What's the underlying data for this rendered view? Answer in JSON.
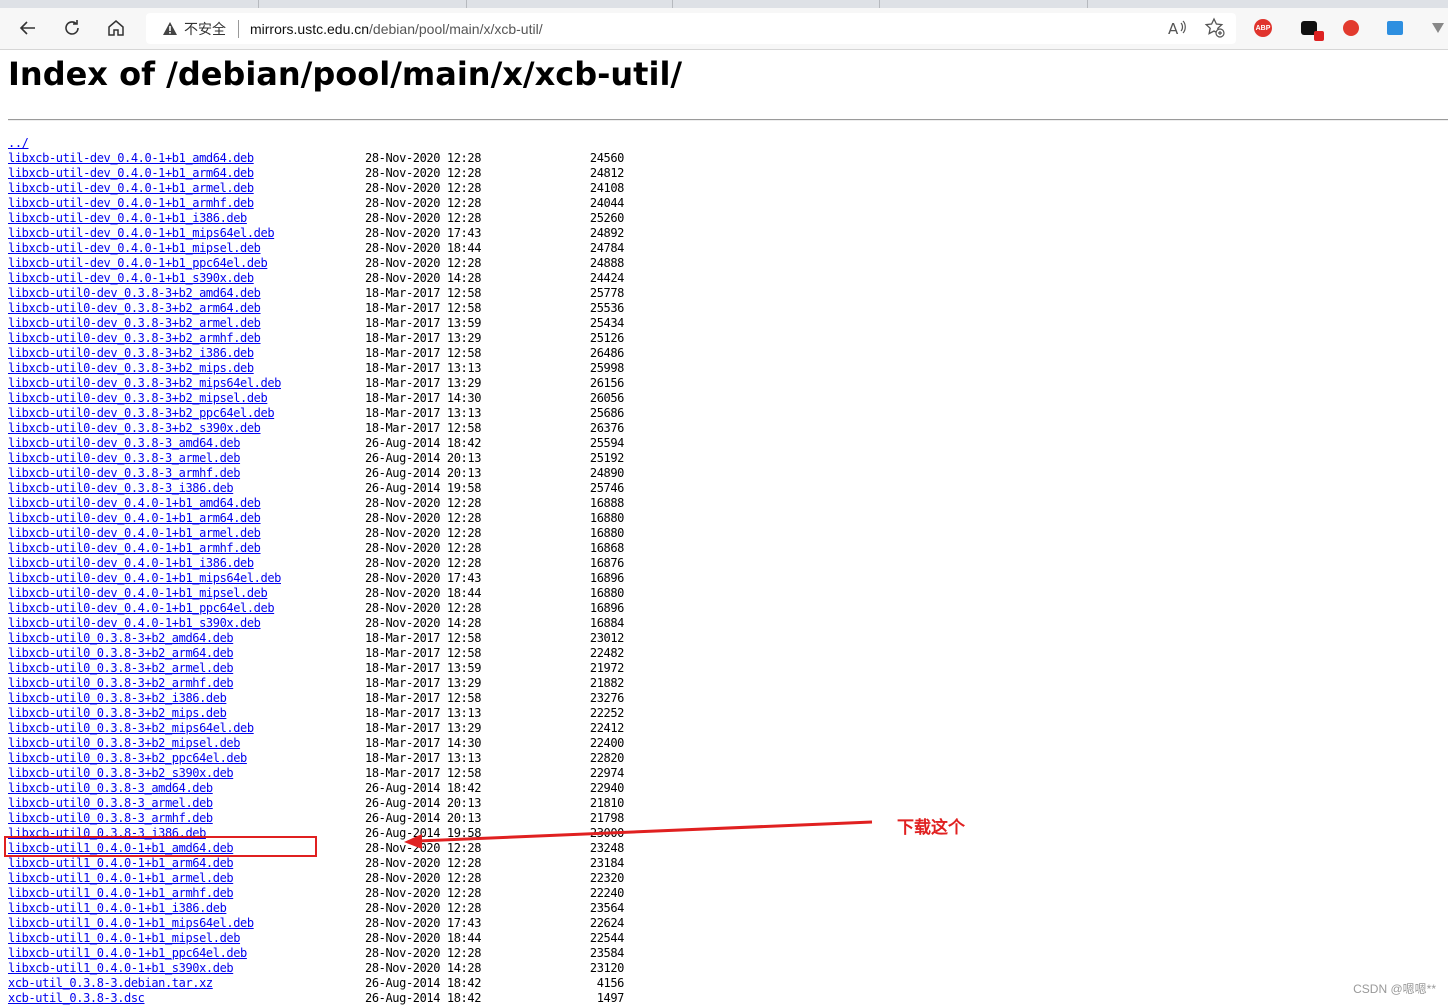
{
  "browser": {
    "insecure_label": "不安全",
    "url_host": "mirrors.ustc.edu.cn",
    "url_path": "/debian/pool/main/x/xcb-util/"
  },
  "page": {
    "title": "Index of /debian/pool/main/x/xcb-util/",
    "parent_link": "../",
    "entries": [
      {
        "name": "libxcb-util-dev_0.4.0-1+b1_amd64.deb",
        "date": "28-Nov-2020 12:28",
        "size": "24560"
      },
      {
        "name": "libxcb-util-dev_0.4.0-1+b1_arm64.deb",
        "date": "28-Nov-2020 12:28",
        "size": "24812"
      },
      {
        "name": "libxcb-util-dev_0.4.0-1+b1_armel.deb",
        "date": "28-Nov-2020 12:28",
        "size": "24108"
      },
      {
        "name": "libxcb-util-dev_0.4.0-1+b1_armhf.deb",
        "date": "28-Nov-2020 12:28",
        "size": "24044"
      },
      {
        "name": "libxcb-util-dev_0.4.0-1+b1_i386.deb",
        "date": "28-Nov-2020 12:28",
        "size": "25260"
      },
      {
        "name": "libxcb-util-dev_0.4.0-1+b1_mips64el.deb",
        "date": "28-Nov-2020 17:43",
        "size": "24892"
      },
      {
        "name": "libxcb-util-dev_0.4.0-1+b1_mipsel.deb",
        "date": "28-Nov-2020 18:44",
        "size": "24784"
      },
      {
        "name": "libxcb-util-dev_0.4.0-1+b1_ppc64el.deb",
        "date": "28-Nov-2020 12:28",
        "size": "24888"
      },
      {
        "name": "libxcb-util-dev_0.4.0-1+b1_s390x.deb",
        "date": "28-Nov-2020 14:28",
        "size": "24424"
      },
      {
        "name": "libxcb-util0-dev_0.3.8-3+b2_amd64.deb",
        "date": "18-Mar-2017 12:58",
        "size": "25778"
      },
      {
        "name": "libxcb-util0-dev_0.3.8-3+b2_arm64.deb",
        "date": "18-Mar-2017 12:58",
        "size": "25536"
      },
      {
        "name": "libxcb-util0-dev_0.3.8-3+b2_armel.deb",
        "date": "18-Mar-2017 13:59",
        "size": "25434"
      },
      {
        "name": "libxcb-util0-dev_0.3.8-3+b2_armhf.deb",
        "date": "18-Mar-2017 13:29",
        "size": "25126"
      },
      {
        "name": "libxcb-util0-dev_0.3.8-3+b2_i386.deb",
        "date": "18-Mar-2017 12:58",
        "size": "26486"
      },
      {
        "name": "libxcb-util0-dev_0.3.8-3+b2_mips.deb",
        "date": "18-Mar-2017 13:13",
        "size": "25998"
      },
      {
        "name": "libxcb-util0-dev_0.3.8-3+b2_mips64el.deb",
        "date": "18-Mar-2017 13:29",
        "size": "26156"
      },
      {
        "name": "libxcb-util0-dev_0.3.8-3+b2_mipsel.deb",
        "date": "18-Mar-2017 14:30",
        "size": "26056"
      },
      {
        "name": "libxcb-util0-dev_0.3.8-3+b2_ppc64el.deb",
        "date": "18-Mar-2017 13:13",
        "size": "25686"
      },
      {
        "name": "libxcb-util0-dev_0.3.8-3+b2_s390x.deb",
        "date": "18-Mar-2017 12:58",
        "size": "26376"
      },
      {
        "name": "libxcb-util0-dev_0.3.8-3_amd64.deb",
        "date": "26-Aug-2014 18:42",
        "size": "25594"
      },
      {
        "name": "libxcb-util0-dev_0.3.8-3_armel.deb",
        "date": "26-Aug-2014 20:13",
        "size": "25192"
      },
      {
        "name": "libxcb-util0-dev_0.3.8-3_armhf.deb",
        "date": "26-Aug-2014 20:13",
        "size": "24890"
      },
      {
        "name": "libxcb-util0-dev_0.3.8-3_i386.deb",
        "date": "26-Aug-2014 19:58",
        "size": "25746"
      },
      {
        "name": "libxcb-util0-dev_0.4.0-1+b1_amd64.deb",
        "date": "28-Nov-2020 12:28",
        "size": "16888"
      },
      {
        "name": "libxcb-util0-dev_0.4.0-1+b1_arm64.deb",
        "date": "28-Nov-2020 12:28",
        "size": "16880"
      },
      {
        "name": "libxcb-util0-dev_0.4.0-1+b1_armel.deb",
        "date": "28-Nov-2020 12:28",
        "size": "16880"
      },
      {
        "name": "libxcb-util0-dev_0.4.0-1+b1_armhf.deb",
        "date": "28-Nov-2020 12:28",
        "size": "16868"
      },
      {
        "name": "libxcb-util0-dev_0.4.0-1+b1_i386.deb",
        "date": "28-Nov-2020 12:28",
        "size": "16876"
      },
      {
        "name": "libxcb-util0-dev_0.4.0-1+b1_mips64el.deb",
        "date": "28-Nov-2020 17:43",
        "size": "16896"
      },
      {
        "name": "libxcb-util0-dev_0.4.0-1+b1_mipsel.deb",
        "date": "28-Nov-2020 18:44",
        "size": "16880"
      },
      {
        "name": "libxcb-util0-dev_0.4.0-1+b1_ppc64el.deb",
        "date": "28-Nov-2020 12:28",
        "size": "16896"
      },
      {
        "name": "libxcb-util0-dev_0.4.0-1+b1_s390x.deb",
        "date": "28-Nov-2020 14:28",
        "size": "16884"
      },
      {
        "name": "libxcb-util0_0.3.8-3+b2_amd64.deb",
        "date": "18-Mar-2017 12:58",
        "size": "23012"
      },
      {
        "name": "libxcb-util0_0.3.8-3+b2_arm64.deb",
        "date": "18-Mar-2017 12:58",
        "size": "22482"
      },
      {
        "name": "libxcb-util0_0.3.8-3+b2_armel.deb",
        "date": "18-Mar-2017 13:59",
        "size": "21972"
      },
      {
        "name": "libxcb-util0_0.3.8-3+b2_armhf.deb",
        "date": "18-Mar-2017 13:29",
        "size": "21882"
      },
      {
        "name": "libxcb-util0_0.3.8-3+b2_i386.deb",
        "date": "18-Mar-2017 12:58",
        "size": "23276"
      },
      {
        "name": "libxcb-util0_0.3.8-3+b2_mips.deb",
        "date": "18-Mar-2017 13:13",
        "size": "22252"
      },
      {
        "name": "libxcb-util0_0.3.8-3+b2_mips64el.deb",
        "date": "18-Mar-2017 13:29",
        "size": "22412"
      },
      {
        "name": "libxcb-util0_0.3.8-3+b2_mipsel.deb",
        "date": "18-Mar-2017 14:30",
        "size": "22400"
      },
      {
        "name": "libxcb-util0_0.3.8-3+b2_ppc64el.deb",
        "date": "18-Mar-2017 13:13",
        "size": "22820"
      },
      {
        "name": "libxcb-util0_0.3.8-3+b2_s390x.deb",
        "date": "18-Mar-2017 12:58",
        "size": "22974"
      },
      {
        "name": "libxcb-util0_0.3.8-3_amd64.deb",
        "date": "26-Aug-2014 18:42",
        "size": "22940"
      },
      {
        "name": "libxcb-util0_0.3.8-3_armel.deb",
        "date": "26-Aug-2014 20:13",
        "size": "21810"
      },
      {
        "name": "libxcb-util0_0.3.8-3_armhf.deb",
        "date": "26-Aug-2014 20:13",
        "size": "21798"
      },
      {
        "name": "libxcb-util0_0.3.8-3_i386.deb",
        "date": "26-Aug-2014 19:58",
        "size": "23000"
      },
      {
        "name": "libxcb-util1_0.4.0-1+b1_amd64.deb",
        "date": "28-Nov-2020 12:28",
        "size": "23248"
      },
      {
        "name": "libxcb-util1_0.4.0-1+b1_arm64.deb",
        "date": "28-Nov-2020 12:28",
        "size": "23184"
      },
      {
        "name": "libxcb-util1_0.4.0-1+b1_armel.deb",
        "date": "28-Nov-2020 12:28",
        "size": "22320"
      },
      {
        "name": "libxcb-util1_0.4.0-1+b1_armhf.deb",
        "date": "28-Nov-2020 12:28",
        "size": "22240"
      },
      {
        "name": "libxcb-util1_0.4.0-1+b1_i386.deb",
        "date": "28-Nov-2020 12:28",
        "size": "23564"
      },
      {
        "name": "libxcb-util1_0.4.0-1+b1_mips64el.deb",
        "date": "28-Nov-2020 17:43",
        "size": "22624"
      },
      {
        "name": "libxcb-util1_0.4.0-1+b1_mipsel.deb",
        "date": "28-Nov-2020 18:44",
        "size": "22544"
      },
      {
        "name": "libxcb-util1_0.4.0-1+b1_ppc64el.deb",
        "date": "28-Nov-2020 12:28",
        "size": "23584"
      },
      {
        "name": "libxcb-util1_0.4.0-1+b1_s390x.deb",
        "date": "28-Nov-2020 14:28",
        "size": "23120"
      },
      {
        "name": "xcb-util_0.3.8-3.debian.tar.xz",
        "date": "26-Aug-2014 18:42",
        "size": "4156"
      },
      {
        "name": "xcb-util_0.3.8-3.dsc",
        "date": "26-Aug-2014 18:42",
        "size": "1497"
      }
    ]
  },
  "annotation": {
    "text": "下载这个",
    "color": "#e02020"
  },
  "watermark": "CSDN @嗯嗯**"
}
